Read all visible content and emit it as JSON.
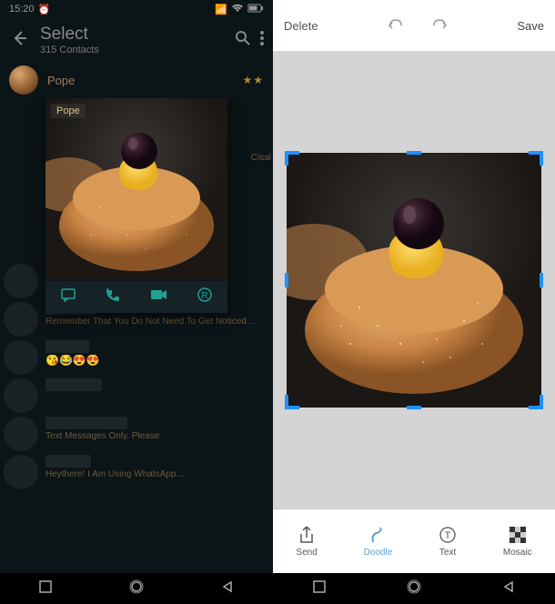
{
  "status": {
    "time": "15:20",
    "alarm": "⏰"
  },
  "header": {
    "title": "Select",
    "subtitle": "315 Contacts"
  },
  "top_contact": {
    "name": "Pope",
    "side_text": "Cisal"
  },
  "preview": {
    "label": "Pope"
  },
  "contacts": [
    {
      "status": ""
    },
    {
      "status": "Remember That You Do Not Need To Get Noticed…"
    },
    {
      "status": "😘😂😍😍",
      "emoji": true
    },
    {
      "status": ""
    },
    {
      "status": "Text Messages Only, Please"
    },
    {
      "status": "Heythere! I Am Using WhatsApp…"
    }
  ],
  "editor": {
    "delete": "Delete",
    "save": "Save",
    "tools": {
      "send": "Send",
      "doodle": "Doodle",
      "text": "Text",
      "mosaic": "Mosaic"
    }
  },
  "colors": {
    "teal": "#1fa193",
    "crop_handle": "#1e90ff"
  }
}
